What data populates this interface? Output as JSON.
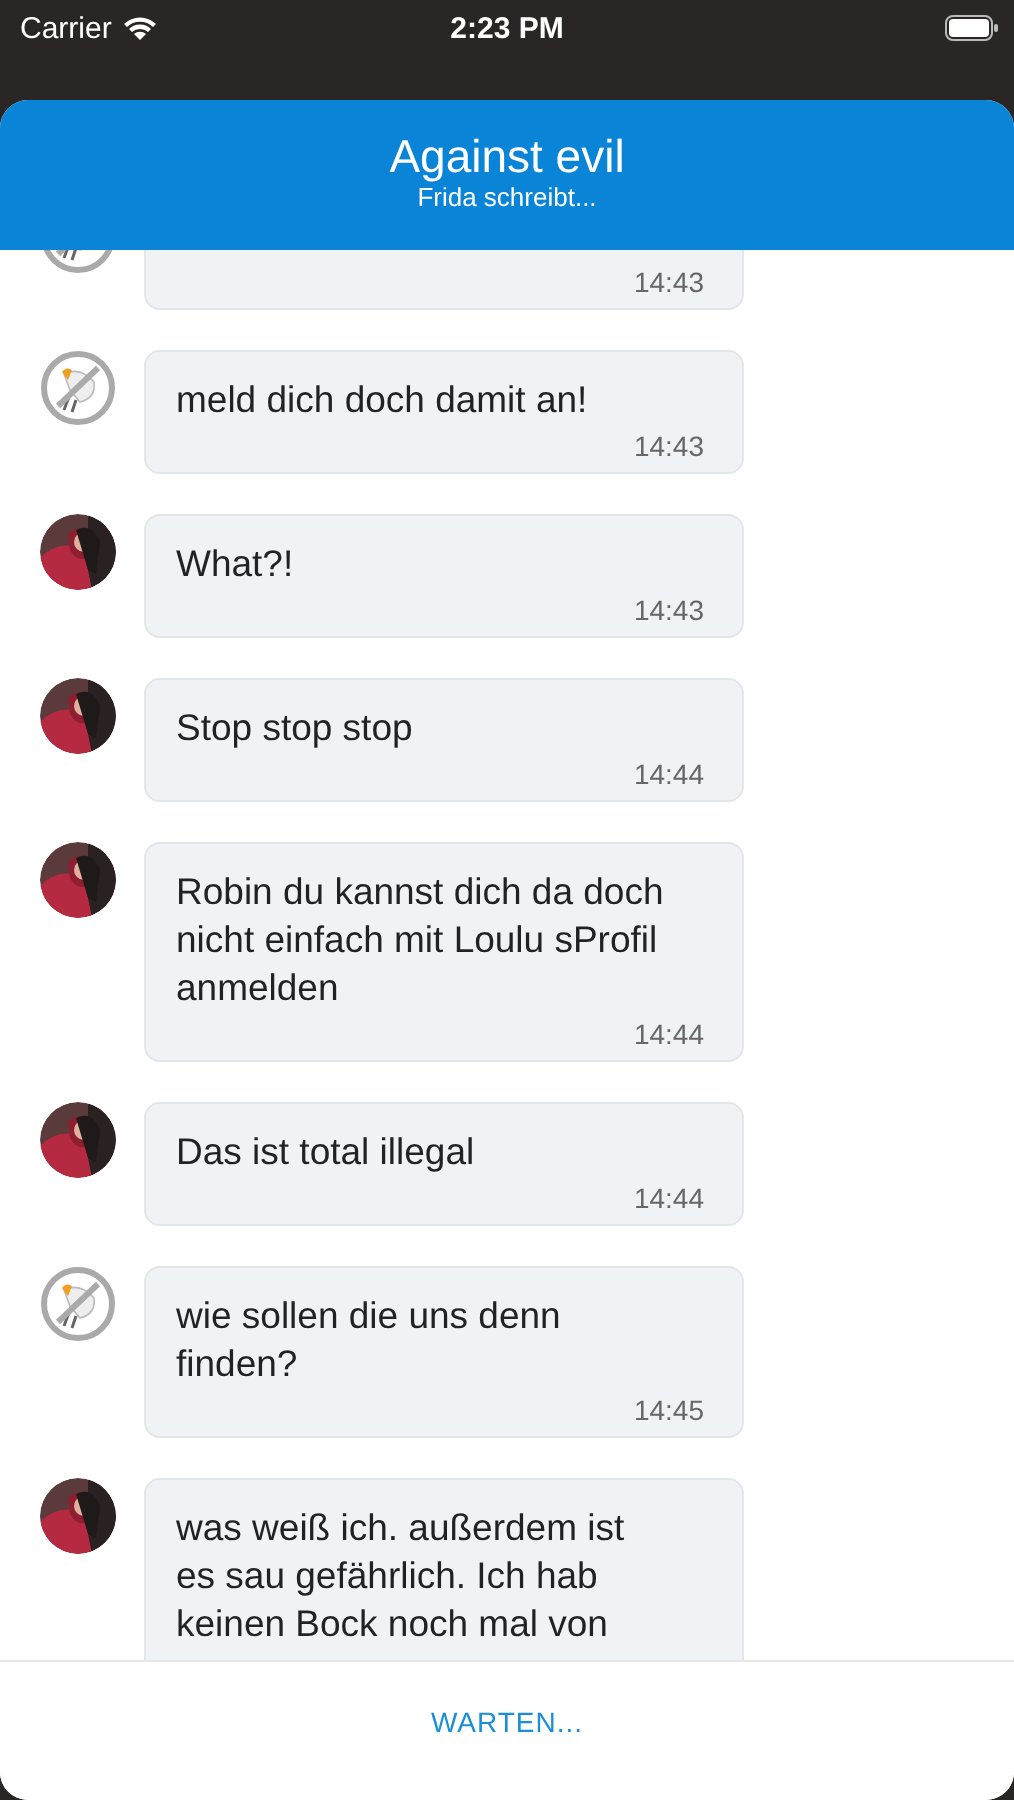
{
  "status_bar": {
    "carrier": "Carrier",
    "time": "2:23 PM"
  },
  "header": {
    "title": "Against evil",
    "subtitle": "Frida schreibt..."
  },
  "messages": [
    {
      "avatar": {
        "kind": "bird"
      },
      "time": "14:43",
      "cut_top": true,
      "cut_bottom": false
    },
    {
      "avatar": {
        "kind": "bird"
      },
      "text": "meld dich doch damit an!",
      "time": "14:43",
      "cut_top": false,
      "cut_bottom": false
    },
    {
      "text": "What?!",
      "time": "14:43",
      "cut_top": false,
      "cut_bottom": false
    },
    {
      "text": "Stop stop stop",
      "time": "14:44",
      "cut_top": false,
      "cut_bottom": false
    },
    {
      "text": "Robin du kannst dich da doch\nnicht einfach mit Loulu sProfil\nanmelden",
      "time": "14:44",
      "cut_top": false,
      "cut_bottom": false
    },
    {
      "text": "Das ist total illegal",
      "time": "14:44",
      "cut_top": false,
      "cut_bottom": false
    },
    {
      "avatar": {
        "kind": "bird"
      },
      "text": "wie sollen die uns denn\nfinden?",
      "time": "14:45",
      "cut_top": false,
      "cut_bottom": false
    },
    {
      "text": "was weiß ich. außerdem ist\nes sau gefährlich. Ich hab\nkeinen Bock noch mal von",
      "cut_top": false,
      "cut_bottom": true
    }
  ],
  "footer": {
    "button": "WARTEN..."
  }
}
